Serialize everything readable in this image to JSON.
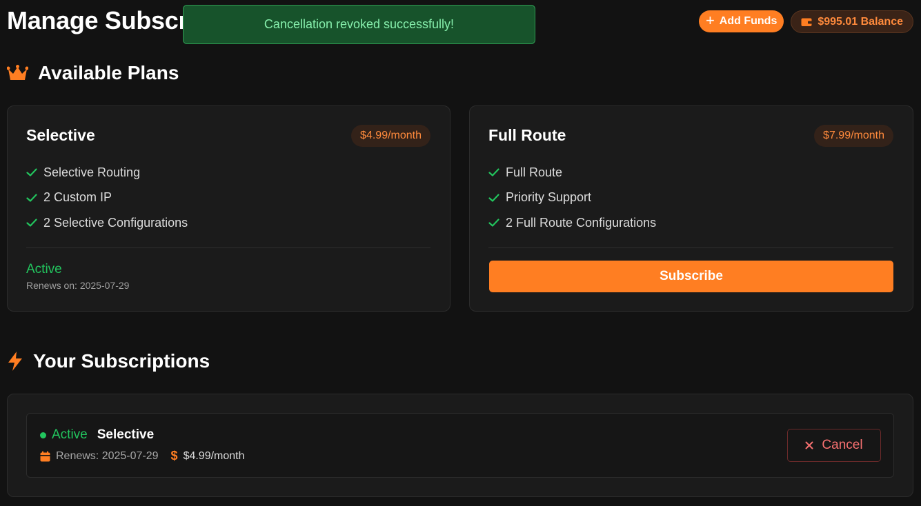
{
  "header": {
    "title": "Manage Subscriptions",
    "add_funds_label": "Add Funds",
    "balance_label": "$995.01 Balance"
  },
  "toast": {
    "message": "Cancellation revoked successfully!"
  },
  "plans_section": {
    "title": "Available Plans",
    "plans": [
      {
        "name": "Selective",
        "price": "$4.99/month",
        "features": [
          "Selective Routing",
          "2 Custom IP",
          "2 Selective Configurations"
        ],
        "status": "Active",
        "renews": "Renews on: 2025-07-29"
      },
      {
        "name": "Full Route",
        "price": "$7.99/month",
        "features": [
          "Full Route",
          "Priority Support",
          "2 Full Route Configurations"
        ],
        "action_label": "Subscribe"
      }
    ]
  },
  "subscriptions_section": {
    "title": "Your Subscriptions",
    "items": [
      {
        "status": "Active",
        "plan": "Selective",
        "renews": "Renews: 2025-07-29",
        "price": "$4.99/month",
        "cancel_label": "Cancel"
      }
    ]
  },
  "colors": {
    "accent": "#ff7e22",
    "success": "#22c55e",
    "danger": "#f87171",
    "background": "#121212",
    "card": "#1b1b1b"
  },
  "icons": {
    "section_plans": "crown-icon",
    "section_subscriptions": "lightning-icon",
    "add_funds": "plus-icon",
    "balance": "wallet-icon",
    "feature": "check-icon",
    "renew": "calendar-icon",
    "price": "dollar-icon",
    "cancel": "x-icon"
  }
}
